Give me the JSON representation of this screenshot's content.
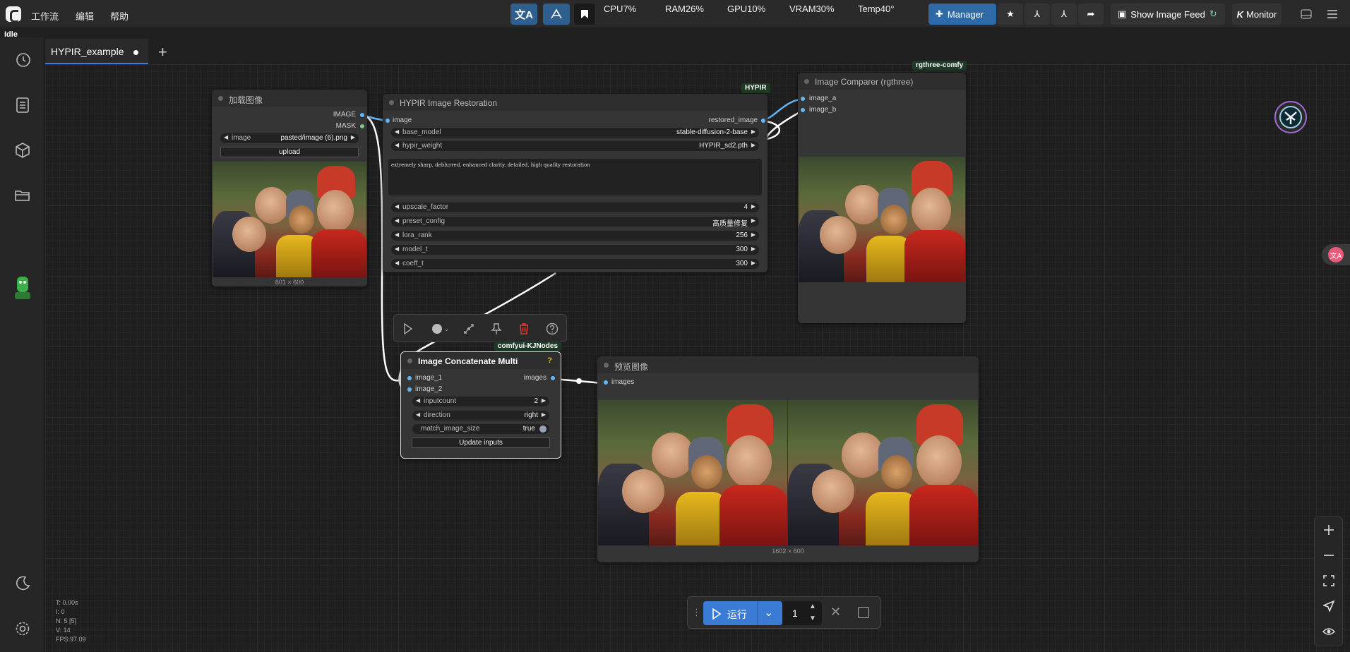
{
  "status": "Idle",
  "menu": {
    "workflow": "工作流",
    "edit": "编辑",
    "help": "帮助"
  },
  "stats": {
    "cpu": "CPU7%",
    "ram": "RAM26%",
    "gpu": "GPU10%",
    "vram": "VRAM30%",
    "temp": "Temp40°"
  },
  "toolbar": {
    "manager": "Manager",
    "image_feed": "Show Image Feed",
    "monitor": "Monitor"
  },
  "tab": {
    "name": "HYPIR_example",
    "add": "+"
  },
  "nodes": {
    "load_image": {
      "title": "加载图像",
      "out_image": "IMAGE",
      "out_mask": "MASK",
      "widget_label": "image",
      "widget_value": "pasted/image (6).png",
      "upload": "upload",
      "caption": "801 × 600"
    },
    "hypir": {
      "badge": "HYPIR",
      "title": "HYPIR Image Restoration",
      "in_image": "image",
      "out": "restored_image",
      "widgets": [
        {
          "label": "base_model",
          "value": "stable-diffusion-2-base"
        },
        {
          "label": "hypir_weight",
          "value": "HYPIR_sd2.pth"
        }
      ],
      "prompt": "extremely sharp, deblurred, enhanced clarity, detailed, high quality restoration",
      "params": [
        {
          "label": "upscale_factor",
          "value": "4"
        },
        {
          "label": "preset_config",
          "value": "高质量修复"
        },
        {
          "label": "lora_rank",
          "value": "256"
        },
        {
          "label": "model_t",
          "value": "300"
        },
        {
          "label": "coeff_t",
          "value": "300"
        }
      ]
    },
    "comparer": {
      "badge": "rgthree-comfy",
      "title": "Image Comparer (rgthree)",
      "in_a": "image_a",
      "in_b": "image_b"
    },
    "concat": {
      "badge": "comfyui-KJNodes",
      "title": "Image Concatenate Multi",
      "help": "?",
      "in_1": "image_1",
      "in_2": "image_2",
      "out": "images",
      "widgets": [
        {
          "label": "inputcount",
          "value": "2"
        },
        {
          "label": "direction",
          "value": "right"
        },
        {
          "label": "match_image_size",
          "value": "true"
        }
      ],
      "update": "Update inputs"
    },
    "preview": {
      "title": "预览图像",
      "in_images": "images",
      "caption": "1602 × 600"
    }
  },
  "run": {
    "label": "运行",
    "count": "1"
  },
  "perf": {
    "t": "T: 0.00s",
    "i": "I: 0",
    "n": "N: 5 [5]",
    "v": "V: 14",
    "fps": "FPS:97.09"
  },
  "colors": {
    "accent": "#3a7bd5",
    "image_port": "#64b5f6",
    "mask_port": "#81c784",
    "delete": "#e53935"
  },
  "icons": [
    "history-icon",
    "queue-icon",
    "model-library-icon",
    "workflows-icon",
    "theme-icon",
    "settings-icon"
  ]
}
